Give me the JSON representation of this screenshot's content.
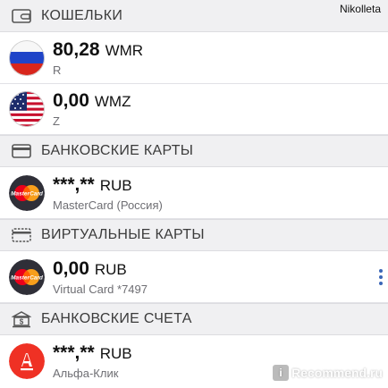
{
  "user": {
    "name": "Nikolleta"
  },
  "sections": {
    "wallets": {
      "title": "КОШЕЛЬКИ",
      "items": [
        {
          "amount": "80,28",
          "currency": "WMR",
          "sub": "R",
          "icon": "russia-flag-icon"
        },
        {
          "amount": "0,00",
          "currency": "WMZ",
          "sub": "Z",
          "icon": "usa-flag-icon"
        }
      ]
    },
    "bank_cards": {
      "title": "БАНКОВСКИЕ КАРТЫ",
      "items": [
        {
          "amount": "***,**",
          "currency": "RUB",
          "sub": "MasterCard (Россия)",
          "icon": "mastercard-icon"
        }
      ]
    },
    "virtual_cards": {
      "title": "ВИРТУАЛЬНЫЕ КАРТЫ",
      "items": [
        {
          "amount": "0,00",
          "currency": "RUB",
          "sub": "Virtual Card *7497",
          "icon": "mastercard-icon"
        }
      ]
    },
    "bank_accounts": {
      "title": "БАНКОВСКИЕ СЧЕТА",
      "items": [
        {
          "amount": "***,**",
          "currency": "RUB",
          "sub": "Альфа-Клик",
          "icon": "alfa-bank-icon"
        }
      ]
    }
  },
  "watermark": {
    "badge": "i",
    "text": "Recommend.ru"
  },
  "colors": {
    "header_bg": "#f0f0f2",
    "alfa_red": "#ef3124",
    "mastercard_red": "#eb001b",
    "mastercard_yellow": "#f79e1b",
    "dots_blue": "#3a66b7"
  }
}
